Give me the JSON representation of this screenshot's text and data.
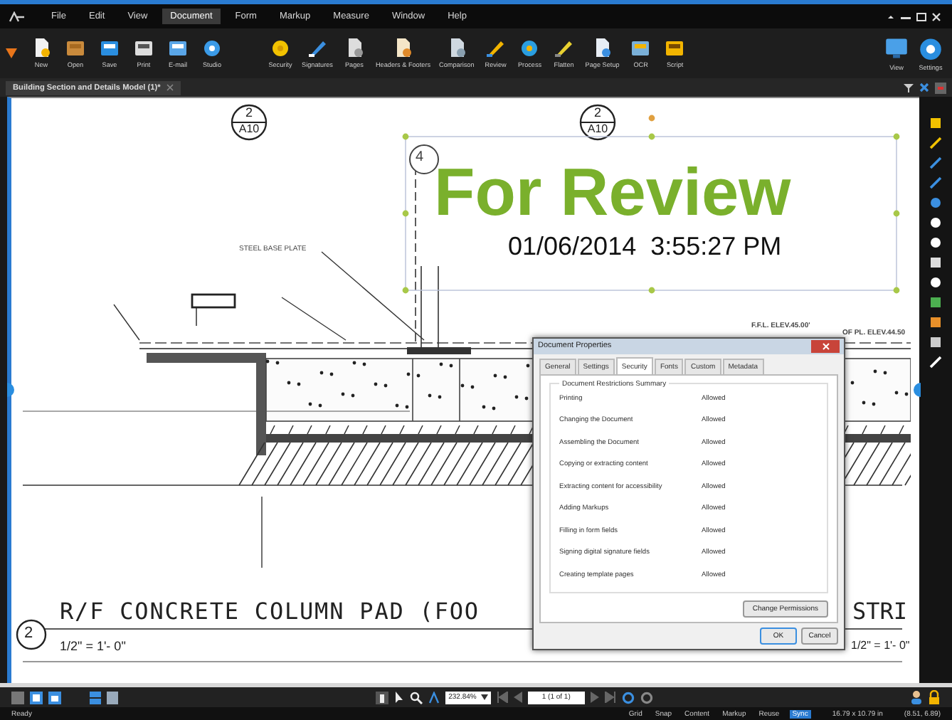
{
  "menu_bar": {
    "items": [
      {
        "label": "File",
        "selected": false
      },
      {
        "label": "Edit",
        "selected": false
      },
      {
        "label": "View",
        "selected": false
      },
      {
        "label": "Document",
        "selected": true
      },
      {
        "label": "Form",
        "selected": false
      },
      {
        "label": "Markup",
        "selected": false
      },
      {
        "label": "Measure",
        "selected": false
      },
      {
        "label": "Window",
        "selected": false
      },
      {
        "label": "Help",
        "selected": false
      }
    ]
  },
  "toolbar": {
    "file_group": [
      {
        "label": "New"
      },
      {
        "label": "Open"
      },
      {
        "label": "Save"
      },
      {
        "label": "Print"
      },
      {
        "label": "E-mail"
      },
      {
        "label": "Studio"
      }
    ],
    "document_group": [
      {
        "label": "Security"
      },
      {
        "label": "Signatures"
      },
      {
        "label": "Pages"
      },
      {
        "label": "Headers & Footers"
      },
      {
        "label": "Comparison"
      },
      {
        "label": "Review"
      },
      {
        "label": "Process"
      },
      {
        "label": "Flatten"
      },
      {
        "label": "Page Setup"
      },
      {
        "label": "OCR"
      },
      {
        "label": "Script"
      }
    ],
    "right_group": [
      {
        "label": "View"
      },
      {
        "label": "Settings"
      }
    ]
  },
  "document_tab": {
    "title": "Building Section and Details Model (1)*"
  },
  "drawing": {
    "section_markers": [
      {
        "number": "2",
        "sheet": "A10"
      },
      {
        "number": "2",
        "sheet": "A10"
      }
    ],
    "detail_number": "4",
    "labels": [
      {
        "text": "STEEL BASE PLATE"
      },
      {
        "text": "F.F.L. ELEV.45.00'"
      },
      {
        "text": "OF PL. ELEV.44.50"
      }
    ],
    "title_marker": "2",
    "title": "R/F CONCRETE COLUMN PAD (FOO",
    "title_right": "STRI",
    "scales": [
      "1/2\" = 1'- 0\"",
      "1/2\" = 1'- 0\""
    ]
  },
  "stamp": {
    "title": "For Review",
    "timestamp": "01/06/2014  3:55:27 PM"
  },
  "dialog": {
    "title": "Document Properties",
    "tabs": [
      {
        "label": "General",
        "selected": false
      },
      {
        "label": "Settings",
        "selected": false
      },
      {
        "label": "Security",
        "selected": true
      },
      {
        "label": "Fonts",
        "selected": false
      },
      {
        "label": "Custom",
        "selected": false
      },
      {
        "label": "Metadata",
        "selected": false
      }
    ],
    "group_title": "Document Restrictions Summary",
    "rows": [
      {
        "name": "Printing",
        "value": "Allowed"
      },
      {
        "name": "Changing the Document",
        "value": "Allowed"
      },
      {
        "name": "Assembling the Document",
        "value": "Allowed"
      },
      {
        "name": "Copying or extracting content",
        "value": "Allowed"
      },
      {
        "name": "Extracting content for accessibility",
        "value": "Allowed"
      },
      {
        "name": "Adding Markups",
        "value": "Allowed"
      },
      {
        "name": "Filling in form fields",
        "value": "Allowed"
      },
      {
        "name": "Signing digital signature fields",
        "value": "Allowed"
      },
      {
        "name": "Creating template pages",
        "value": "Allowed"
      }
    ],
    "change_button": "Change Permissions",
    "buttons": [
      "OK",
      "Cancel"
    ]
  },
  "bottom_toolbar": {
    "zoom": "232.84%",
    "page": "1 (1 of 1)"
  },
  "status_bar": {
    "status": "Ready",
    "toggles": [
      {
        "label": "Grid",
        "selected": false
      },
      {
        "label": "Snap",
        "selected": false
      },
      {
        "label": "Content",
        "selected": false
      },
      {
        "label": "Markup",
        "selected": false
      },
      {
        "label": "Reuse",
        "selected": false
      },
      {
        "label": "Sync",
        "selected": true
      }
    ],
    "size": "16.79 x 10.79 in",
    "coordinates": "(8.51, 6.89)"
  }
}
